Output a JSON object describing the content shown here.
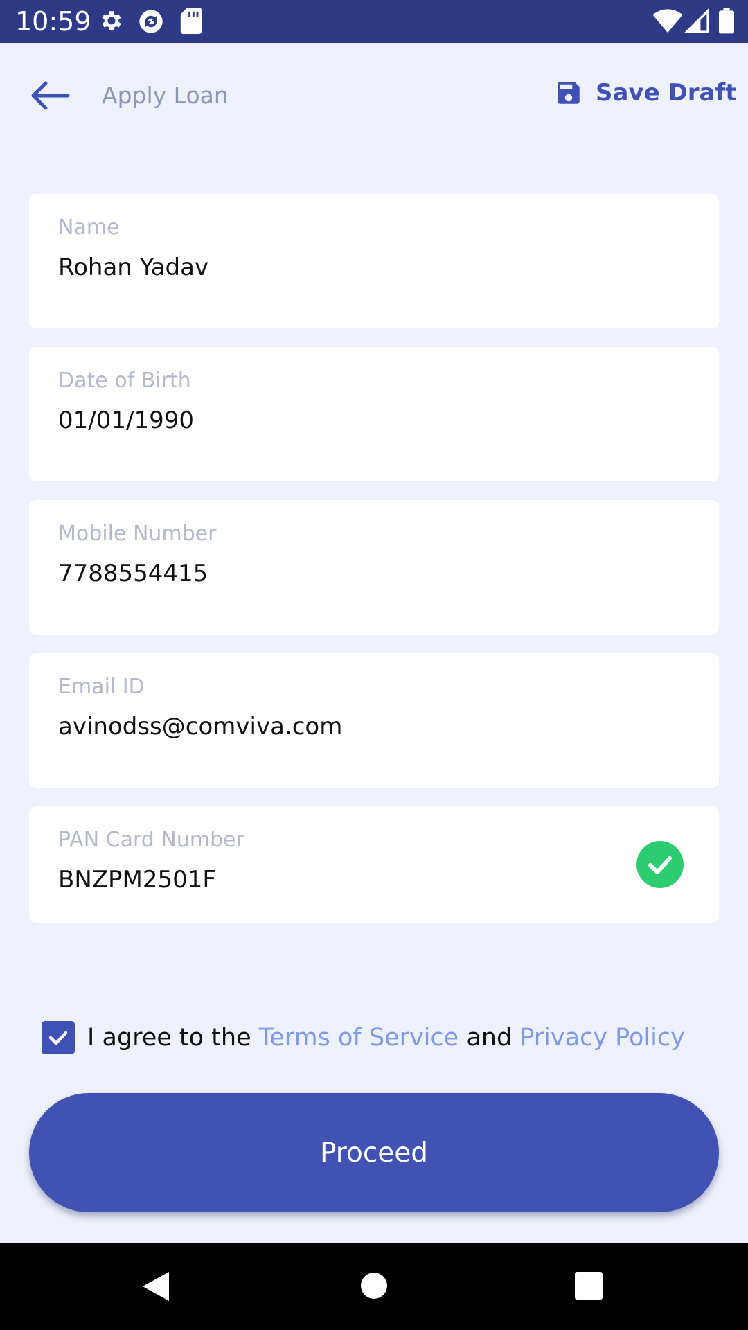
{
  "status_bar": {
    "time": "10:59",
    "left_icons": [
      "gear-icon",
      "sync-icon",
      "sd-card-icon"
    ],
    "right_icons": [
      "wifi-icon",
      "cellular-signal-icon",
      "battery-icon"
    ]
  },
  "header": {
    "title": "Apply Loan",
    "save_draft_label": "Save Draft"
  },
  "form": {
    "fields": [
      {
        "label": "Name",
        "value": "Rohan Yadav"
      },
      {
        "label": "Date of Birth",
        "value": "01/01/1990"
      },
      {
        "label": "Mobile Number",
        "value": "7788554415"
      },
      {
        "label": "Email ID",
        "value": "avinodss@comviva.com"
      },
      {
        "label": "PAN Card Number",
        "value": "BNZPM2501F",
        "verified": true
      }
    ]
  },
  "terms": {
    "checked": true,
    "prefix": "I agree to the ",
    "terms_link": "Terms of Service",
    "conjunction": " and ",
    "privacy_link": "Privacy Policy"
  },
  "proceed_label": "Proceed",
  "colors": {
    "primary": "#3f51b5",
    "status_bar": "#2f3a86",
    "background": "#eef1f9",
    "link": "#7e9ae6",
    "verified": "#2ecc71"
  }
}
